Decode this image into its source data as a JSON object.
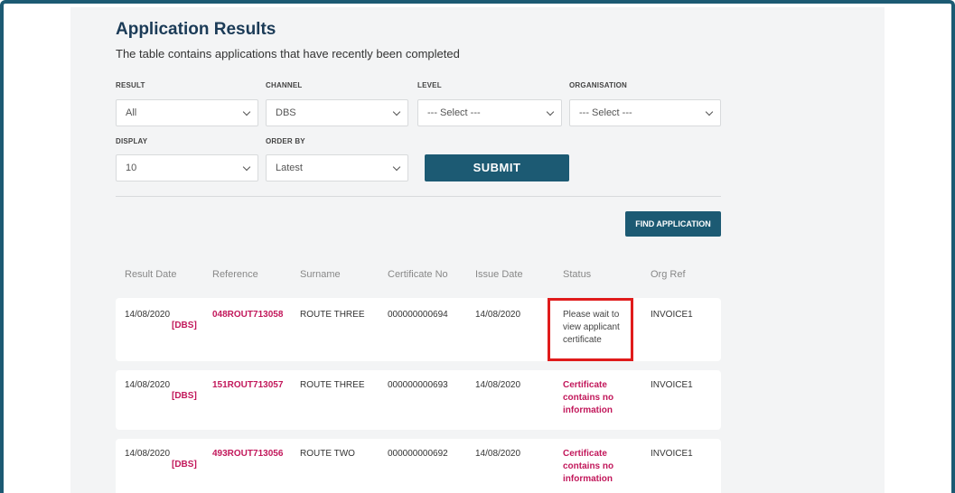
{
  "page": {
    "title": "Application Results",
    "subtitle": "The table contains applications that have recently been completed"
  },
  "filters": {
    "result": {
      "label": "RESULT",
      "value": "All"
    },
    "channel": {
      "label": "CHANNEL",
      "value": "DBS"
    },
    "level": {
      "label": "LEVEL",
      "value": "--- Select ---"
    },
    "organisation": {
      "label": "ORGANISATION",
      "value": "--- Select ---"
    },
    "display": {
      "label": "DISPLAY",
      "value": "10"
    },
    "order_by": {
      "label": "ORDER BY",
      "value": "Latest"
    }
  },
  "buttons": {
    "submit": "SUBMIT",
    "find_application": "FIND APPLICATION"
  },
  "table": {
    "headers": [
      "Result Date",
      "Reference",
      "Surname",
      "Certificate No",
      "Issue Date",
      "Status",
      "Org Ref"
    ],
    "rows": [
      {
        "result_date": "14/08/2020",
        "channel": "[DBS]",
        "reference": "048ROUT713058",
        "surname": "ROUTE THREE",
        "certificate_no": "000000000694",
        "issue_date": "14/08/2020",
        "status": "Please wait to view applicant certificate",
        "org_ref": "INVOICE1"
      },
      {
        "result_date": "14/08/2020",
        "channel": "[DBS]",
        "reference": "151ROUT713057",
        "surname": "ROUTE THREE",
        "certificate_no": "000000000693",
        "issue_date": "14/08/2020",
        "status": "Certificate contains no information",
        "org_ref": "INVOICE1"
      },
      {
        "result_date": "14/08/2020",
        "channel": "[DBS]",
        "reference": "493ROUT713056",
        "surname": "ROUTE TWO",
        "certificate_no": "000000000692",
        "issue_date": "14/08/2020",
        "status": "Certificate contains no information",
        "org_ref": "INVOICE1"
      }
    ]
  },
  "colors": {
    "brand": "#1c5a73",
    "link": "#c2185b",
    "highlight": "#e01b1b",
    "panel_bg": "#f3f4f5"
  }
}
